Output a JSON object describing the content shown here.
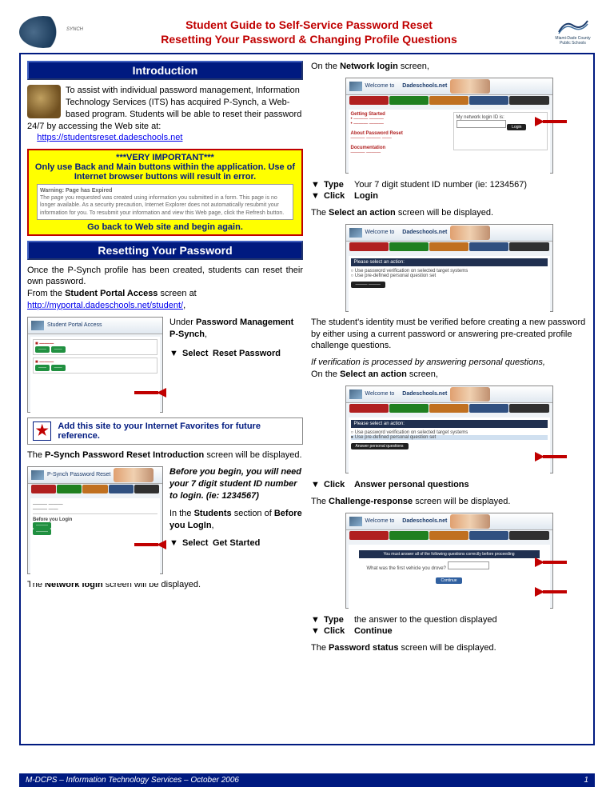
{
  "header": {
    "title_line1": "Student Guide to Self-Service Password Reset",
    "title_line2": "Resetting Your Password & Changing Profile Questions",
    "right_logo_text": "Miami-Dade County Public Schools"
  },
  "left": {
    "sec1_title": "Introduction",
    "intro": "To assist with individual password management, Information Technology Services (ITS) has acquired P-Synch, a Web-based program. Students will be able to reset their password 24/7 by accessing the Web site at:",
    "intro_link": "https://studentsreset.dadeschools.net",
    "warn_hdr": "***VERY IMPORTANT***",
    "warn_body": "Only use Back and Main buttons within the application. Use of Internet browser buttons will result in error.",
    "warn_inner_title": "Warning: Page has Expired",
    "warn_inner_body": "The page you requested was created using information you submitted in a form. This page is no longer available. As a security precaution, Internet Explorer does not automatically resubmit your information for you.\nTo resubmit your information and view this Web page, click the Refresh button.",
    "warn_footer": "Go back to Web site and begin again.",
    "sec2_title": "Resetting Your Password",
    "reset_intro1": "Once the P-Synch profile has been created, students can reset their own password.",
    "reset_intro2_pre": "From the ",
    "reset_intro2_bold": "Student Portal Access",
    "reset_intro2_post": " screen at",
    "reset_link": "http://myportal.dadeschools.net/student/",
    "under_lbl_pre": "Under ",
    "under_lbl_bold": "Password Management P-Synch",
    "under_lbl_post": ",",
    "step_select": "Select",
    "step_reset_pw": "Reset Password",
    "tip_text": "Add this site to your Internet Favorites for future reference.",
    "psynch_intro_pre": "The ",
    "psynch_intro_bold": "P-Synch Password Reset Introduction",
    "psynch_intro_post": " screen will be displayed.",
    "before_text": "Before you begin, you will need your 7 digit student ID number to login. (ie: 1234567)",
    "in_students_pre": "In the ",
    "in_students_bold": "Students",
    "in_students_post": " section of ",
    "in_students_bold2": "Before you LogIn",
    "step_get_started": "Get Started",
    "netlogin_pre": "The ",
    "netlogin_bold": "Network login",
    "netlogin_post": " screen will be displayed.",
    "shot1_welcome": "Dadeschools.net",
    "shot1_portal": "Student Portal Access"
  },
  "right": {
    "onnet_pre": "On the ",
    "onnet_bold": "Network login",
    "onnet_post": " screen,",
    "type_lbl": "Type",
    "type_val": "Your 7 digit student ID number (ie: 1234567)",
    "click_lbl": "Click",
    "click_login": "Login",
    "selaction_pre": "The ",
    "selaction_bold": "Select an action",
    "selaction_post": " screen will be displayed.",
    "identity_text": "The student's identity must be verified before creating a new password by either using a current password or answering pre-created profile challenge questions.",
    "ifverif": "If verification is processed by answering personal questions,",
    "onsel_pre": "On the ",
    "onsel_bold": "Select an action",
    "onsel_post": " screen,",
    "click_answer": "Answer personal questions",
    "chresp_pre": "The ",
    "chresp_bold": "Challenge-response",
    "chresp_post": " screen will be displayed.",
    "type_answer": "the answer to the question displayed",
    "click_continue": "Continue",
    "pwstatus_pre": "The ",
    "pwstatus_bold": "Password status",
    "pwstatus_post": " screen will be displayed.",
    "shot_welcome": "Welcome to",
    "shot_dade": "Dadeschools.net",
    "shot_netlogin": "My network login ID is:",
    "shot_selact": "Please select an action:",
    "shot_opt1": "Use password verification on selected target systems",
    "shot_opt2": "Use pre-defined personal question set"
  },
  "footer": {
    "text": "M-DCPS – Information Technology Services – October 2006",
    "page": "1"
  }
}
